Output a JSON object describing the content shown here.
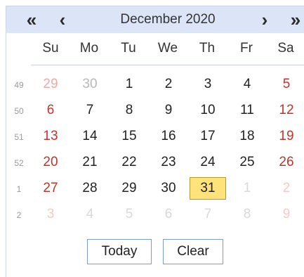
{
  "header": {
    "prev_year": "«",
    "prev_month": "‹",
    "title": "December 2020",
    "next_month": "›",
    "next_year": "»"
  },
  "weekdays": [
    "Su",
    "Mo",
    "Tu",
    "We",
    "Th",
    "Fr",
    "Sa"
  ],
  "week_numbers": [
    "49",
    "50",
    "51",
    "52",
    "1",
    "2"
  ],
  "weeks": [
    [
      "29",
      "30",
      "1",
      "2",
      "3",
      "4",
      "5"
    ],
    [
      "6",
      "7",
      "8",
      "9",
      "10",
      "11",
      "12"
    ],
    [
      "13",
      "14",
      "15",
      "16",
      "17",
      "18",
      "19"
    ],
    [
      "20",
      "21",
      "22",
      "23",
      "24",
      "25",
      "26"
    ],
    [
      "27",
      "28",
      "29",
      "30",
      "31",
      "1",
      "2"
    ],
    [
      "3",
      "4",
      "5",
      "6",
      "7",
      "8",
      "9"
    ]
  ],
  "selected_date": "31",
  "buttons": {
    "today": "Today",
    "clear": "Clear"
  },
  "colors": {
    "header_bg": "#dce5f7",
    "weekend_text": "#c4332a",
    "selected_bg": "#ffe27a",
    "button_border": "#7c9bd6"
  }
}
